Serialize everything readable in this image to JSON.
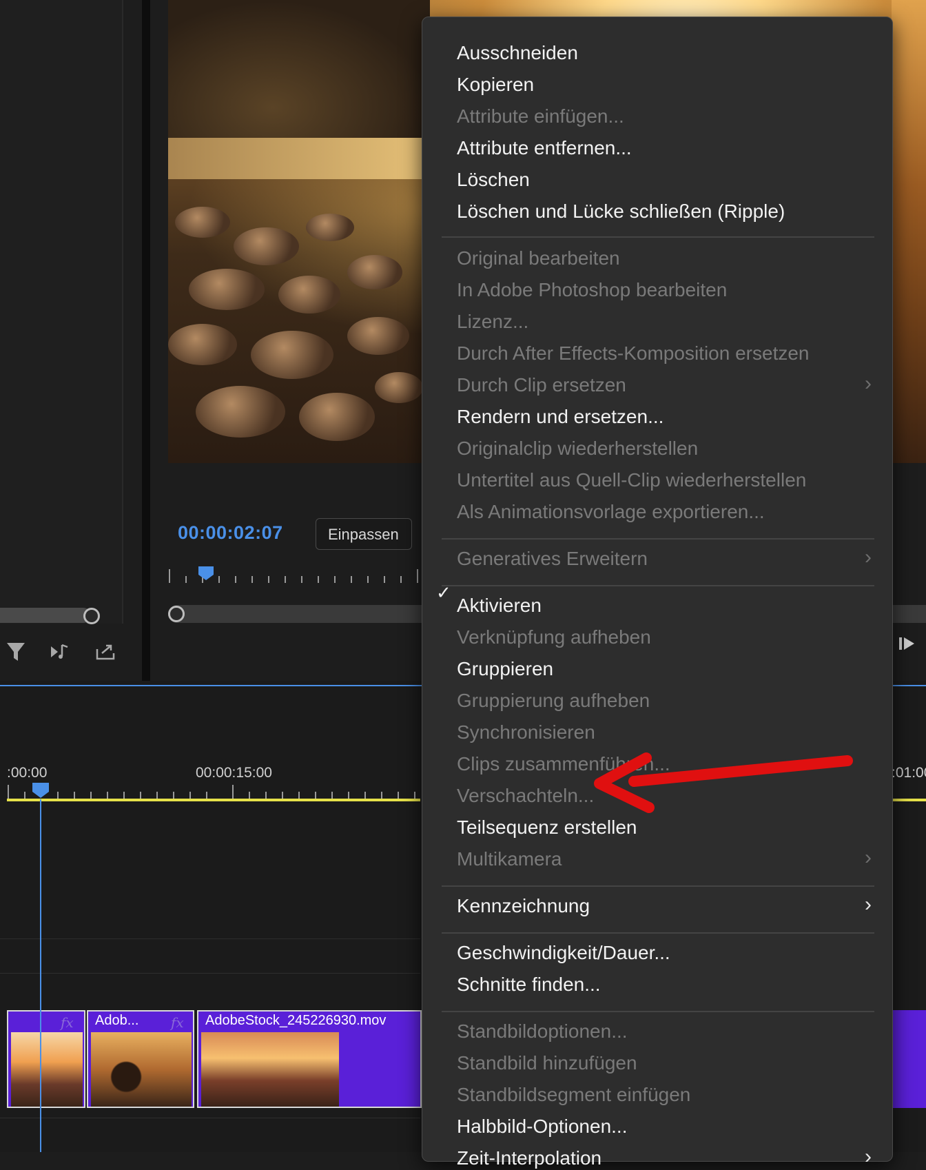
{
  "monitor": {
    "timecode": "00:00:02:07",
    "fit_label": "Einpassen"
  },
  "timeline": {
    "ruler_labels": [
      ":00:00",
      "00:00:15:00",
      ":01:00"
    ],
    "clips": [
      {
        "title": "",
        "fx": "fx"
      },
      {
        "title": "Adob...",
        "fx": "fx"
      },
      {
        "title": "AdobeStock_245226930.mov",
        "fx": ""
      }
    ]
  },
  "context_menu": {
    "items": [
      {
        "label": "Ausschneiden",
        "enabled": true
      },
      {
        "label": "Kopieren",
        "enabled": true
      },
      {
        "label": "Attribute einfügen...",
        "enabled": false
      },
      {
        "label": "Attribute entfernen...",
        "enabled": true
      },
      {
        "label": "Löschen",
        "enabled": true
      },
      {
        "label": "Löschen und Lücke schließen (Ripple)",
        "enabled": true
      },
      {
        "label": "Original bearbeiten",
        "enabled": false
      },
      {
        "label": "In Adobe Photoshop bearbeiten",
        "enabled": false
      },
      {
        "label": "Lizenz...",
        "enabled": false
      },
      {
        "label": "Durch After Effects-Komposition ersetzen",
        "enabled": false
      },
      {
        "label": "Durch Clip ersetzen",
        "enabled": false,
        "submenu": true
      },
      {
        "label": "Rendern und ersetzen...",
        "enabled": true
      },
      {
        "label": "Originalclip wiederherstellen",
        "enabled": false
      },
      {
        "label": "Untertitel aus Quell-Clip wiederherstellen",
        "enabled": false
      },
      {
        "label": "Als Animationsvorlage exportieren...",
        "enabled": false
      },
      {
        "label": "Generatives Erweitern",
        "enabled": false,
        "submenu": true
      },
      {
        "label": "Aktivieren",
        "enabled": true,
        "checked": true
      },
      {
        "label": "Verknüpfung aufheben",
        "enabled": false
      },
      {
        "label": "Gruppieren",
        "enabled": true
      },
      {
        "label": "Gruppierung aufheben",
        "enabled": false
      },
      {
        "label": "Synchronisieren",
        "enabled": false
      },
      {
        "label": "Clips zusammenführen...",
        "enabled": false
      },
      {
        "label": "Verschachteln...",
        "enabled": false
      },
      {
        "label": "Teilsequenz erstellen",
        "enabled": true
      },
      {
        "label": "Multikamera",
        "enabled": false,
        "submenu": true
      },
      {
        "label": "Kennzeichnung",
        "enabled": true,
        "submenu": true
      },
      {
        "label": "Geschwindigkeit/Dauer...",
        "enabled": true
      },
      {
        "label": "Schnitte finden...",
        "enabled": true
      },
      {
        "label": "Standbildoptionen...",
        "enabled": false
      },
      {
        "label": "Standbild hinzufügen",
        "enabled": false
      },
      {
        "label": "Standbildsegment einfügen",
        "enabled": false
      },
      {
        "label": "Halbbild-Optionen...",
        "enabled": true
      },
      {
        "label": "Zeit-Interpolation",
        "enabled": true,
        "submenu": true
      }
    ],
    "checkmark": "✓",
    "chevron": "›"
  },
  "colors": {
    "accent_blue": "#4a90e8",
    "clip_purple": "#5a20d8",
    "work_area_yellow": "#e6e14a",
    "annotation_arrow": "#e01010"
  },
  "icons": [
    "filter-icon",
    "insert-audio-icon",
    "export-icon",
    "step-forward-icon"
  ]
}
